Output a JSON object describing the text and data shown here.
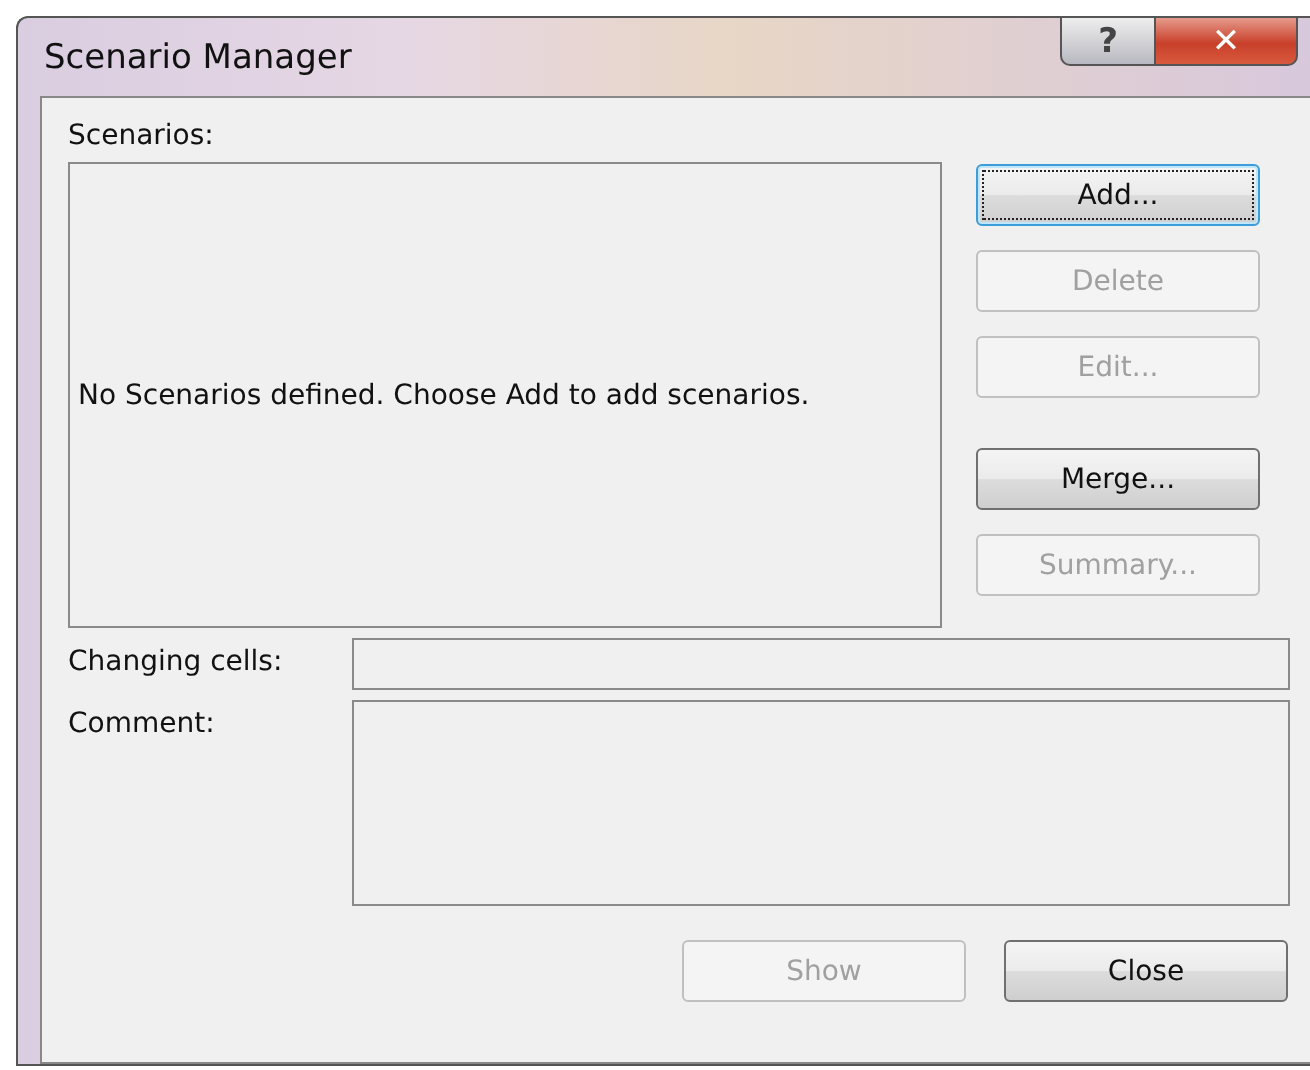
{
  "window": {
    "title": "Scenario Manager",
    "controls": [
      {
        "kind": "help",
        "glyph": "?"
      },
      {
        "kind": "close",
        "glyph": "✕"
      }
    ]
  },
  "scenarios": {
    "label": "Scenarios:",
    "message": "No Scenarios defined. Choose Add to add scenarios."
  },
  "side_button_groups": [
    [
      {
        "label": "Add...",
        "disabled": false,
        "focused": true
      },
      {
        "label": "Delete",
        "disabled": true,
        "focused": false
      },
      {
        "label": "Edit...",
        "disabled": true,
        "focused": false
      }
    ],
    [
      {
        "label": "Merge...",
        "disabled": false,
        "focused": false
      },
      {
        "label": "Summary...",
        "disabled": true,
        "focused": false
      }
    ]
  ],
  "fields": [
    {
      "label": "Changing cells:",
      "kind": "line"
    },
    {
      "label": "Comment:",
      "kind": "area"
    }
  ],
  "bottom_buttons": [
    {
      "label": "Show",
      "disabled": true,
      "focused": false
    },
    {
      "label": "Close",
      "disabled": false,
      "focused": false
    }
  ]
}
